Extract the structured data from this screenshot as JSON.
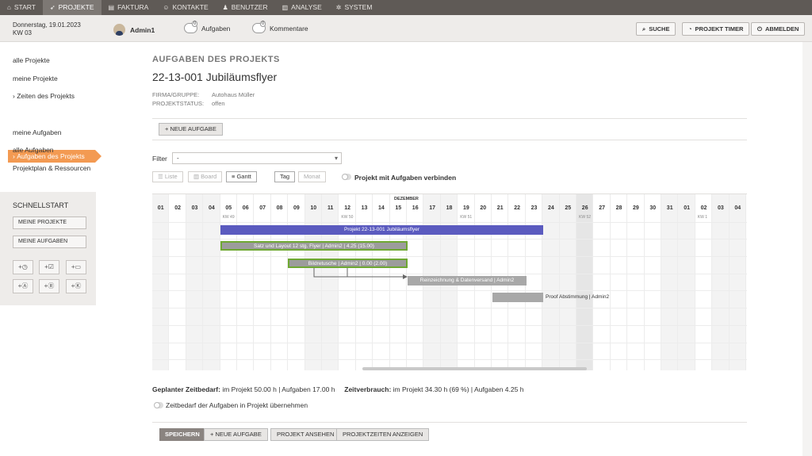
{
  "topnav": [
    {
      "label": "Start",
      "icon": "home-icon",
      "glyph": "⌂",
      "active": false
    },
    {
      "label": "Projekte",
      "icon": "rocket-icon",
      "glyph": "➶",
      "active": true
    },
    {
      "label": "Faktura",
      "icon": "document-icon",
      "glyph": "▤",
      "active": false
    },
    {
      "label": "Kontakte",
      "icon": "people-icon",
      "glyph": "☺",
      "active": false
    },
    {
      "label": "Benutzer",
      "icon": "user-icon",
      "glyph": "♟",
      "active": false
    },
    {
      "label": "Analyse",
      "icon": "chart-icon",
      "glyph": "▥",
      "active": false
    },
    {
      "label": "System",
      "icon": "gear-icon",
      "glyph": "✲",
      "active": false
    }
  ],
  "header": {
    "date": "Donnerstag, 19.01.2023",
    "week": "KW 03",
    "user": "Admin1",
    "tasks_count": "0",
    "tasks_label": "Aufgaben",
    "comments_count": "0",
    "comments_label": "Kommentare",
    "search": "Suche",
    "timer": "Projekt Timer",
    "logout": "Abmelden"
  },
  "sidebar": {
    "items": [
      "alle Projekte",
      "meine Projekte",
      "Zeiten des Projekts",
      "Aufgaben des Projekts",
      "meine Aufgaben",
      "alle Aufgaben",
      "Projektplan & Ressourcen"
    ],
    "quick_title": "SCHNELLSTART",
    "quick_btn1": "MEINE PROJEKTE",
    "quick_btn2": "MEINE AUFGABEN"
  },
  "page": {
    "subtitle": "AUFGABEN DES PROJEKTS",
    "title": "22-13-001 Jubiläumsflyer",
    "firm_label": "FIRMA/GRUPPE:",
    "firm_value": "Autohaus Müller",
    "status_label": "PROJEKTSTATUS:",
    "status_value": "offen",
    "new_task": "Neue Aufgabe",
    "filter_label": "Filter",
    "filter_value": "-",
    "view_list": "Liste",
    "view_board": "Board",
    "view_gantt": "Gantt",
    "view_day": "Tag",
    "view_month": "Monat",
    "connect_label": "Projekt mit Aufgaben verbinden"
  },
  "gantt": {
    "month": "DEZEMBER",
    "days": [
      "01",
      "02",
      "03",
      "04",
      "05",
      "06",
      "07",
      "08",
      "09",
      "10",
      "11",
      "12",
      "13",
      "14",
      "15",
      "16",
      "17",
      "18",
      "19",
      "20",
      "21",
      "22",
      "23",
      "24",
      "25",
      "26",
      "27",
      "28",
      "29",
      "30",
      "31",
      "01",
      "02",
      "03",
      "04"
    ],
    "weekend_days": [
      "03",
      "04",
      "10",
      "11",
      "17",
      "18",
      "24",
      "25",
      "31",
      "01"
    ],
    "today": "26",
    "weeks": [
      {
        "label": "KW 49",
        "day": "05"
      },
      {
        "label": "KW 50",
        "day": "12"
      },
      {
        "label": "KW 51",
        "day": "19"
      },
      {
        "label": "KW 52",
        "day": "26"
      },
      {
        "label": "KW 1",
        "day": "02"
      }
    ],
    "project_bar": "Projekt 22-13-001 Jubiläumsflyer",
    "task1": "Satz und Layout 12 stg. Flyer | Admin2 | 4.25 (15.00)",
    "task2": "Bildretusche | Admin2 | 0.00 (2.00)",
    "task3": "Reinzeichnung & Datenversand | Admin2",
    "task4": "Proof Abstimmung | Admin2"
  },
  "summary": {
    "planned_label": "Geplanter Zeitbedarf:",
    "planned_value": "im Projekt 50.00 h | Aufgaben 17.00 h",
    "used_label": "Zeitverbrauch:",
    "used_value": "im Projekt 34.30 h (69 %) | Aufgaben 4.25 h",
    "apply_label": "Zeitbedarf der Aufgaben in Projekt übernehmen"
  },
  "bottom": {
    "save": "Speichern",
    "new_task": "Neue Aufgabe",
    "view_project": "Projekt ansehen",
    "show_times": "Projektzeiten anzeigen"
  }
}
